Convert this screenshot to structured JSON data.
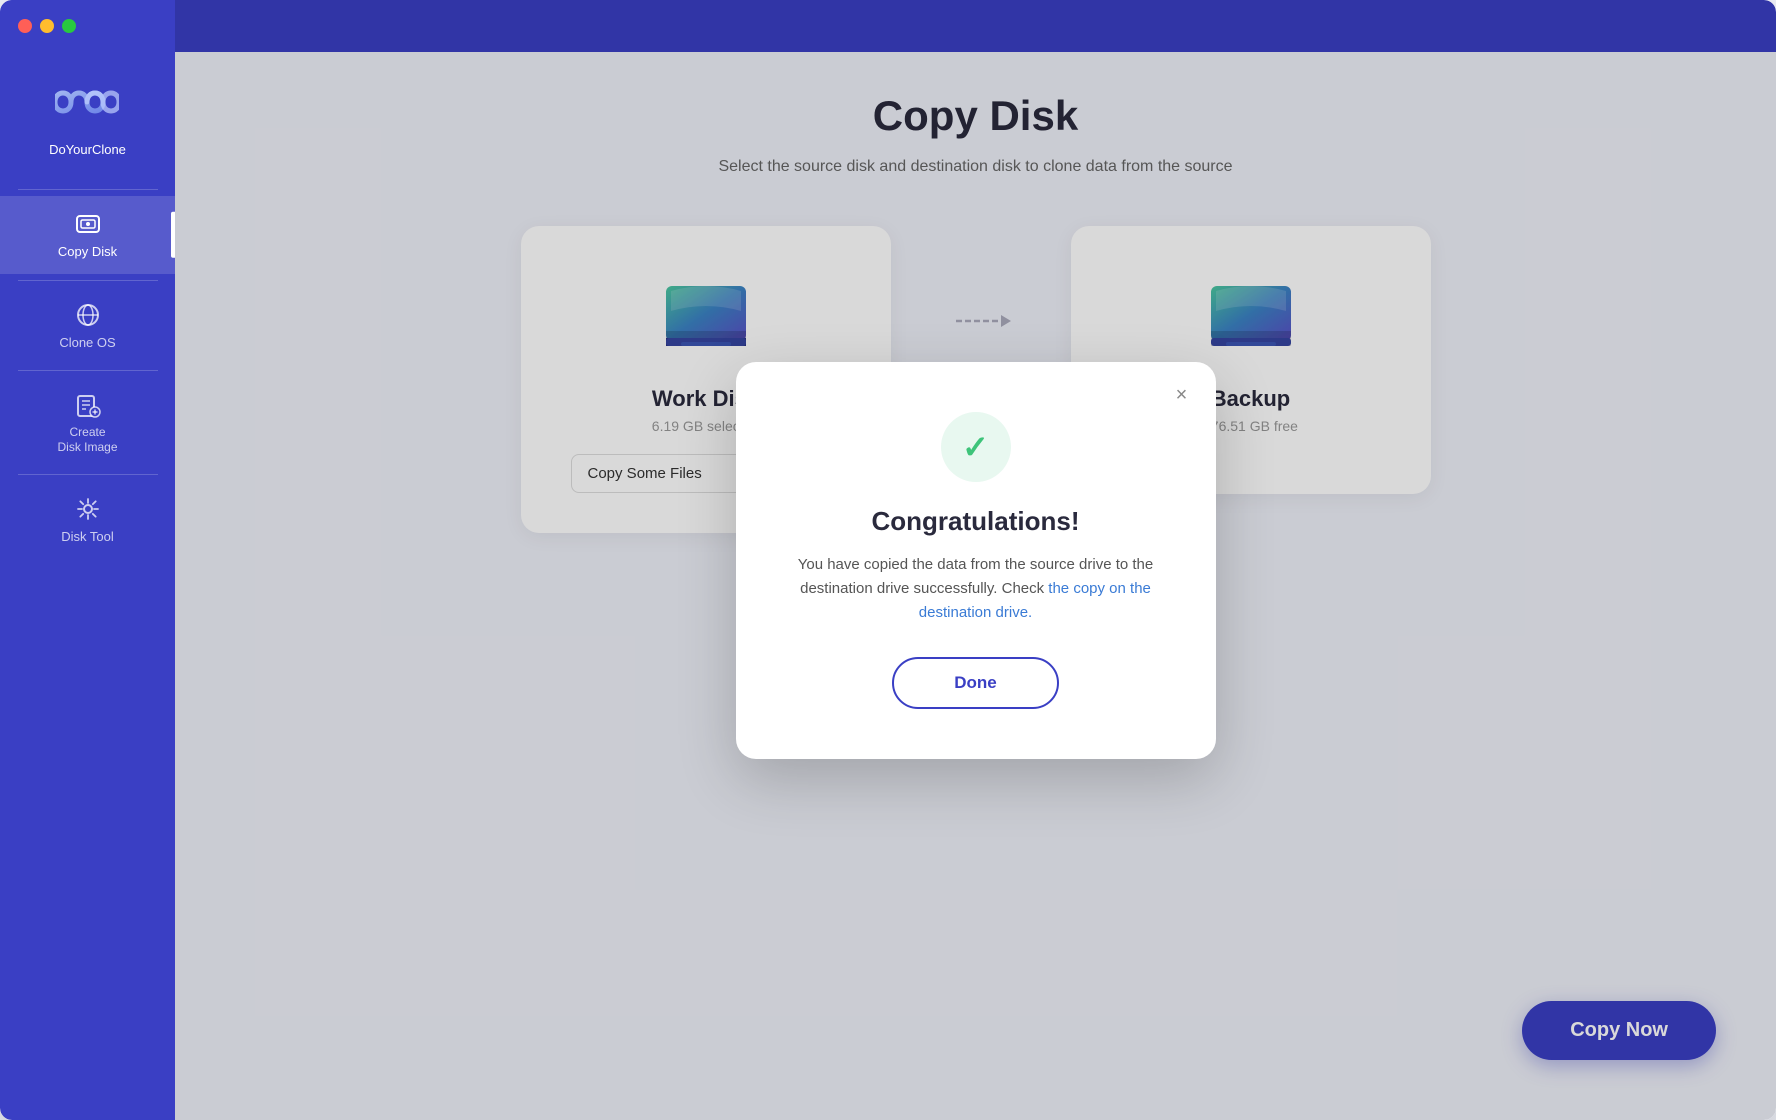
{
  "app": {
    "name": "DoYourClone",
    "window_title": "DoYourClone"
  },
  "sidebar": {
    "items": [
      {
        "id": "copy-disk",
        "label": "Copy Disk",
        "active": true
      },
      {
        "id": "clone-os",
        "label": "Clone OS",
        "active": false
      },
      {
        "id": "create-disk-image",
        "label": "Create\nDisk Image",
        "active": false
      },
      {
        "id": "disk-tool",
        "label": "Disk Tool",
        "active": false
      }
    ]
  },
  "main": {
    "page_title": "Copy Disk",
    "page_subtitle": "Select the source disk and destination disk to clone data from the source",
    "source_disk": {
      "name": "Work Disk",
      "info": "6.19 GB selected"
    },
    "destination_disk": {
      "name": "Backup",
      "info": "176.51 GB free"
    },
    "copy_mode": {
      "label": "Copy Some Files",
      "placeholder": "Copy Some Files"
    },
    "copy_now_label": "Copy Now"
  },
  "modal": {
    "title": "Congratulations!",
    "body": "You have copied the data from the source drive to the destination drive successfully. Check ",
    "link_text": "the copy on the destination drive.",
    "done_label": "Done",
    "close_label": "×"
  }
}
